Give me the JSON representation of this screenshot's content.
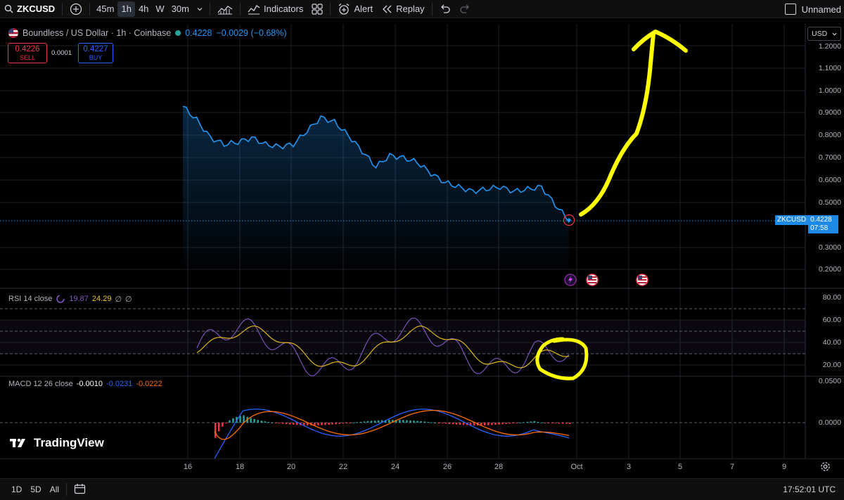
{
  "toolbar": {
    "symbol": "ZKCUSD",
    "timeframes": [
      "45m",
      "1h",
      "4h",
      "W",
      "30m"
    ],
    "active_timeframe": "1h",
    "indicators_label": "Indicators",
    "alert_label": "Alert",
    "replay_label": "Replay",
    "layout_name": "Unnamed"
  },
  "legend": {
    "title": "Boundless / US Dollar · 1h · Coinbase",
    "last": "0.4228",
    "change": "−0.0029 (−0.68%)"
  },
  "trade": {
    "sell_price": "0.4226",
    "sell_label": "SELL",
    "spread": "0.0001",
    "buy_price": "0.4227",
    "buy_label": "BUY"
  },
  "price_scale": {
    "currency": "USD",
    "ticks": [
      "1.2000",
      "1.1000",
      "1.0000",
      "0.9000",
      "0.8000",
      "0.7000",
      "0.6000",
      "0.5000",
      "0.3000",
      "0.2000"
    ],
    "last_symbol": "ZKCUSD",
    "last_price": "0.4228",
    "countdown": "07:58"
  },
  "rsi": {
    "label": "RSI 14 close",
    "value1": "19.87",
    "value2": "24.29",
    "extra1": "∅",
    "extra2": "∅",
    "ticks": [
      "80.00",
      "60.00",
      "40.00",
      "20.00"
    ]
  },
  "macd": {
    "label": "MACD 12 26 close",
    "hist": "-0.0010",
    "macd_val": "-0.0231",
    "signal_val": "-0.0222",
    "ticks": [
      "0.0500",
      "0.0000"
    ]
  },
  "time_axis": [
    "16",
    "18",
    "20",
    "22",
    "24",
    "26",
    "28",
    "Oct",
    "3",
    "5",
    "7",
    "9"
  ],
  "bottom": {
    "ranges": [
      "1D",
      "5D",
      "All"
    ],
    "clock": "17:52:01 UTC"
  },
  "brand": "TradingView",
  "colors": {
    "price_line": "#2196f3",
    "rsi_line": "#7e57c2",
    "rsi_ma": "#f0c419",
    "macd_line": "#2962ff",
    "signal_line": "#ff6d00",
    "annotation": "#ffff00",
    "sell": "#f23645",
    "buy": "#2962ff"
  },
  "chart_data": {
    "type": "line",
    "series": [
      {
        "name": "ZKCUSD",
        "x": [
          "16",
          "16.5",
          "17",
          "17.5",
          "18",
          "18.5",
          "19",
          "19.5",
          "20",
          "20.5",
          "21",
          "21.5",
          "22",
          "22.5",
          "23",
          "23.5",
          "24",
          "24.5",
          "25",
          "25.5",
          "26",
          "26.5",
          "27",
          "27.5",
          "28",
          "28.5",
          "29",
          "29.5",
          "30"
        ],
        "values": [
          0.93,
          0.87,
          0.79,
          0.76,
          0.77,
          0.79,
          0.76,
          0.75,
          0.76,
          0.82,
          0.88,
          0.86,
          0.8,
          0.73,
          0.66,
          0.71,
          0.7,
          0.68,
          0.63,
          0.59,
          0.57,
          0.55,
          0.56,
          0.57,
          0.55,
          0.56,
          0.57,
          0.49,
          0.42
        ]
      }
    ],
    "ylim": [
      0.15,
      1.22
    ]
  }
}
